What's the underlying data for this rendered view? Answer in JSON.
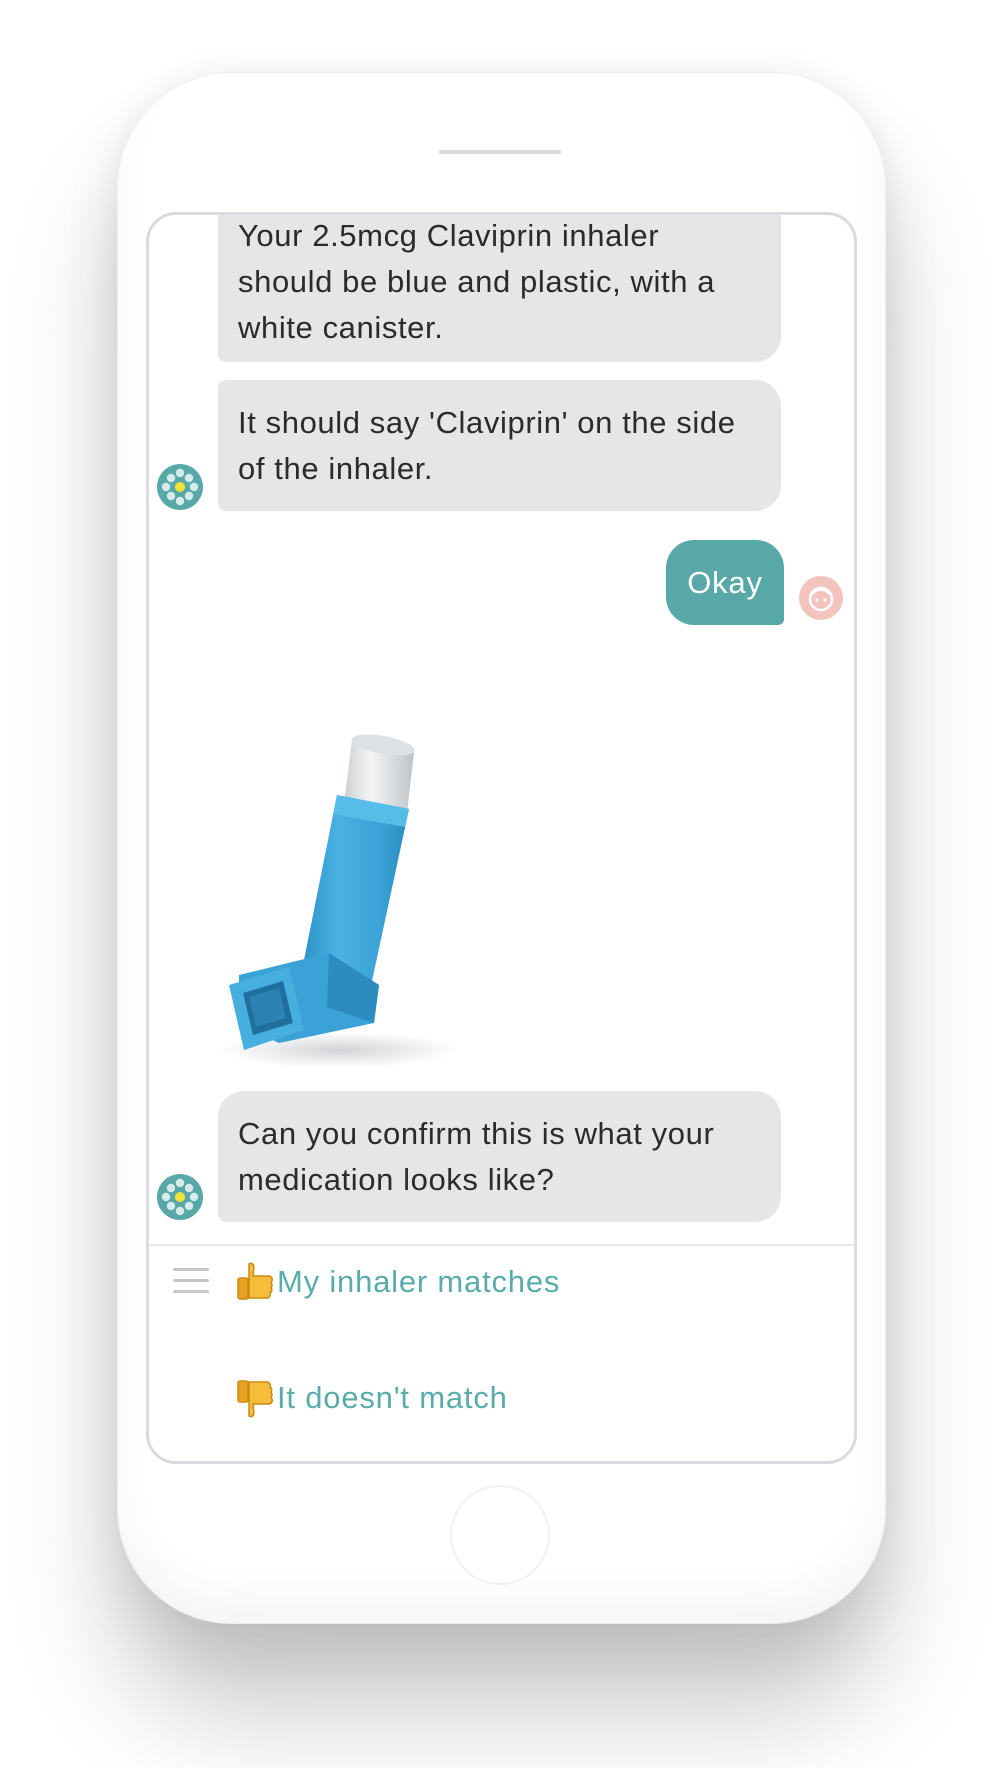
{
  "conversation": {
    "bot_messages": [
      "Your 2.5mcg Claviprin inhaler should be blue and plastic, with a white canister.",
      "It should say 'Claviprin' on the side of the inhaler.",
      "Can you confirm this is what your medication looks like?"
    ],
    "user_reply": "Okay"
  },
  "quick_replies": [
    {
      "label": "My inhaler matches",
      "icon": "thumbs-up-icon"
    },
    {
      "label": "It doesn't match",
      "icon": "thumbs-down-icon"
    }
  ],
  "colors": {
    "accent": "#58a8a8",
    "bot_bubble": "#e6e6e6",
    "user_avatar": "#f3c3bd",
    "inhaler_blue": "#3ea6d9"
  }
}
